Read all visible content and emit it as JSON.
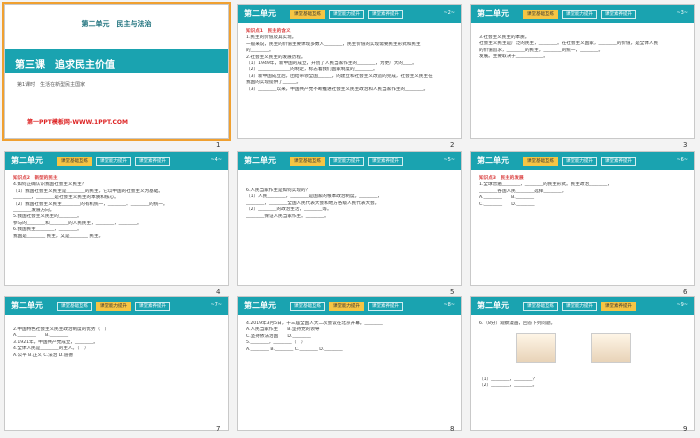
{
  "unit_label": "第二单元",
  "tabs": [
    "课堂基础互练",
    "课堂能力提升",
    "课堂素养提升"
  ],
  "slides": [
    {
      "id": 1,
      "unit_name": "第二单元　民主与法治",
      "lesson_title": "第三课　追求民主价值",
      "section": "第1课时　生活在新型民主国家",
      "site": "第一PPT模板网-WWW.1PPT.COM",
      "number": "1"
    },
    {
      "id": 2,
      "active_tab": 0,
      "page": "~2~",
      "tag": "知识点1　民主的含义",
      "lines": [
        "1.民主的价值及其实现。",
        "一般来说，民主的价值主要体现多数人________，民主价值的实现需要民主形式和民主",
        "的________。",
        "2.社会主义民主的发展历程。",
        "（1）1949年，新中国的成立，开创了人民当家作主的________，为更广大的____。",
        "（2）______________的制定，标志着我们国家制度的________。",
        "（3）新中国成立后，团结带领全国______，的建立和社会主义改造的完成，社会主义民主在",
        "我国的实现提供了______。",
        "（3）________以来，中国共产党不断推进社会主义民主政治和人民当家作主的________。"
      ],
      "number": "2"
    },
    {
      "id": 3,
      "active_tab": 0,
      "page": "~3~",
      "lines": [
        "3.社会主义民主的本质。",
        "社会主义民主是广泛的民主，________。在社会主义国家，________的价值，是全体人民",
        "的价值追求，________的民主，________的统一，________。",
        "发展。主要取决于____________。"
      ],
      "number": "3"
    },
    {
      "id": 4,
      "active_tab": 0,
      "page": "~4~",
      "tag": "知识点2　新型的民主",
      "lines": [
        "4.如何正确认识我国社会主义民主？",
        "（1）我国社会主义民主是________的民主，它以中国的社会主义为基础。",
        "________，________是社会主义民主的本质和核心。",
        "（2）我国社会主义民主________的有机统一，________、________的统一。",
        "________发展方向。",
        "5.我国社会主义民主的________。",
        "参与的________和________的人民民主，________，________。",
        "6.我国民主________，________。",
        "我国是________ 民主，又是________ 民主。"
      ],
      "number": "4"
    },
    {
      "id": 5,
      "active_tab": 0,
      "page": "~5~",
      "lines": [
        "6.人民当家作主是如何实现的？",
        "（1）人民________，________是国家的根本政治制度。________，",
        "________，________全国人民代表大会和地方各级人民代表大会。",
        "（2）________的政治生活，________等。",
        "________保证人民当家作主。________。"
      ],
      "number": "5"
    },
    {
      "id": 6,
      "active_tab": 0,
      "page": "~6~",
      "tag": "知识点3　民主的发展",
      "lines": [
        "1.全球普遍________，________的民主形式。民主政治________，",
        "________各国人民________选择________，",
        "A.________　　B.________",
        "C.________　　D.________"
      ],
      "number": "6"
    },
    {
      "id": 7,
      "active_tab": 1,
      "page": "~7~",
      "lines": [
        "2.中国特色社会主义民主政治制度的优势（　）",
        "A.________　　B.________",
        "3.1921年，中国共产党成立，________。",
        "4.全体人民是________的主人。（　）",
        "A.公平 B.正义 C.法治 D.道德"
      ],
      "number": "7"
    },
    {
      "id": 8,
      "active_tab": 1,
      "page": "~8~",
      "lines": [
        "4.2019年3月5日，十三届全国人大二次会议在北京开幕。________",
        "A.人民当家作主　　B.坚持党的领导",
        "C.坚持依法治国　　D.________",
        "5.________，________（　）",
        "A.________ B.________ C.________ D.________"
      ],
      "number": "8"
    },
    {
      "id": 9,
      "active_tab": 2,
      "page": "~9~",
      "lines": [
        "6.（8分）观察漫画，回答下列问题。",
        "（1）________，________？",
        "（2）________，________。"
      ],
      "number": "9"
    }
  ]
}
